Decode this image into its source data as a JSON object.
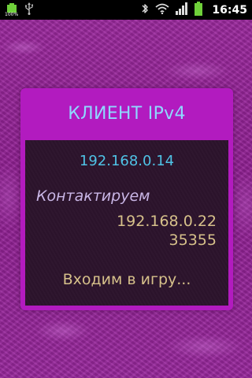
{
  "status_bar": {
    "time": "16:45",
    "battery_percent_label": "100%",
    "icons": [
      "battery-full-icon",
      "usb-icon",
      "bluetooth-icon",
      "wifi-icon",
      "signal-icon",
      "battery-charging-icon"
    ]
  },
  "dialog": {
    "title": "КЛИЕНТ IPv4",
    "server_ip": "192.168.0.14",
    "contact_label": "Контактируем",
    "contact_ip": "192.168.0.22",
    "contact_port": "35355",
    "status_message": "Входим в игру..."
  },
  "colors": {
    "background": "#8c1f8f",
    "dialog_frame": "#b21bbf",
    "dialog_body": "#2c132c",
    "title_text": "#8fd8ff",
    "ip_text": "#4fc3e6",
    "label_text": "#c9b6e6",
    "value_text": "#d6c08a"
  }
}
